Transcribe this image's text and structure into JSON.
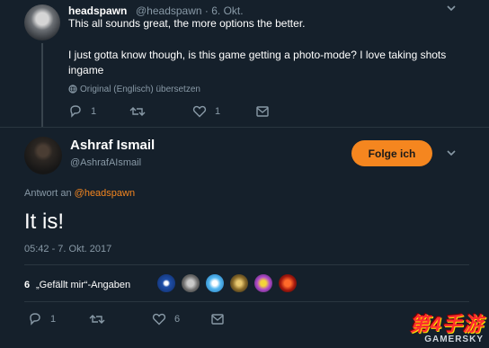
{
  "top_tweet": {
    "name": "headspawn",
    "handle": "@headspawn · 6. Okt.",
    "line1": "This all sounds great, the more options the better.",
    "line2": "I just gotta know though, is this game getting a photo-mode? I love taking shots",
    "line3": "ingame",
    "translate_label": "Original (Englisch) übersetzen",
    "actions": {
      "reply_count": "1",
      "retweet_count": "",
      "like_count": "1"
    }
  },
  "main_tweet": {
    "name": "Ashraf Ismail",
    "handle": "@AshrafAIsmail",
    "follow_label": "Folge ich",
    "reply_prefix": "Antwort an",
    "reply_mention": "@headspawn",
    "text": "It is!",
    "timestamp": "05:42 - 7. Okt. 2017",
    "likes_count": "6",
    "likes_label": "„Gefällt mir“-Angaben",
    "actions": {
      "reply_count": "1",
      "retweet_count": "",
      "like_count": "6"
    }
  },
  "colors": {
    "background": "#15202b",
    "accent": "#f5861f",
    "muted": "#8899a6"
  },
  "watermark": {
    "title": "第4手游",
    "sub": "GAMERSKY"
  }
}
